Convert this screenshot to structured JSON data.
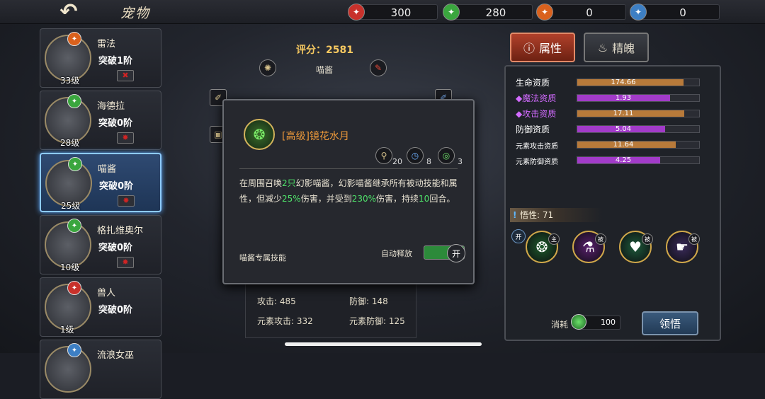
{
  "header": {
    "title": "宠物",
    "back_icon": "back-arrow-icon",
    "currencies": [
      {
        "icon": "red-crystal-icon",
        "color": "#c8312b",
        "value": "300"
      },
      {
        "icon": "green-crystal-icon",
        "color": "#3aa63e",
        "value": "280"
      },
      {
        "icon": "orange-crystal-icon",
        "color": "#d9611d",
        "value": "0"
      },
      {
        "icon": "blue-crystal-icon",
        "color": "#3d7fc4",
        "value": "0"
      }
    ]
  },
  "pets": [
    {
      "name": "雷法",
      "rank": "突破1阶",
      "level": "33级",
      "element_color": "#d9611d"
    },
    {
      "name": "海德拉",
      "rank": "突破0阶",
      "level": "28级",
      "element_color": "#3aa63e"
    },
    {
      "name": "喵酱",
      "rank": "突破0阶",
      "level": "25级",
      "element_color": "#3aa63e",
      "selected": true
    },
    {
      "name": "格扎维奥尔",
      "rank": "突破0阶",
      "level": "10级",
      "element_color": "#3aa63e"
    },
    {
      "name": "兽人",
      "rank": "突破0阶",
      "level": "1级",
      "element_color": "#c8312b"
    },
    {
      "name": "流浪女巫",
      "rank": "",
      "level": "",
      "element_color": "#3d7fc4"
    }
  ],
  "center": {
    "score_label": "评分：2581",
    "pet_name": "喵酱",
    "stats": {
      "attack": "攻击: 485",
      "defense": "防御: 148",
      "elem_attack": "元素攻击: 332",
      "elem_defense": "元素防御: 125"
    }
  },
  "skill_popup": {
    "title": "[高级]镜花水月",
    "cost": "20",
    "cooldown": "8",
    "range": "3",
    "desc_parts": {
      "p1": "在周围召唤",
      "n1": "2只",
      "p2": "幻影喵酱，幻影喵酱继承所有被动技能和属性，但减少",
      "n2": "25%",
      "p3": "伤害，并受到",
      "n3": "230%",
      "p4": "伤害，持续",
      "n4": "10",
      "p5": "回合。"
    },
    "type_label": "喵酱专属技能",
    "auto_label": "自动释放",
    "toggle_label": "开"
  },
  "right": {
    "tabs": [
      {
        "label": "属性",
        "icon": "info-icon"
      },
      {
        "label": "精魄",
        "icon": "flame-icon"
      }
    ],
    "attributes": [
      {
        "label": "生命资质",
        "value": "174.66",
        "fill": 0.87,
        "color": "#b87a3a",
        "style": "normal"
      },
      {
        "label": "◆魔法资质",
        "value": "1.93",
        "fill": 0.76,
        "color": "#a23bc9",
        "style": "purple"
      },
      {
        "label": "◆攻击资质",
        "value": "17.11",
        "fill": 0.88,
        "color": "#b87a3a",
        "style": "purple"
      },
      {
        "label": "防御资质",
        "value": "5.04",
        "fill": 0.72,
        "color": "#a23bc9",
        "style": "normal"
      },
      {
        "label": "元素攻击资质",
        "value": "11.64",
        "fill": 0.81,
        "color": "#b87a3a",
        "style": "small"
      },
      {
        "label": "元素防御资质",
        "value": "4.25",
        "fill": 0.68,
        "color": "#a23bc9",
        "style": "small"
      }
    ],
    "insight": "悟性: 71",
    "open_badge": "开",
    "abilities": [
      {
        "tag": "主",
        "bg": "#1d5a2a"
      },
      {
        "tag": "被",
        "bg": "#5a1f6e"
      },
      {
        "tag": "被",
        "bg": "#1d5a3a"
      },
      {
        "tag": "被",
        "bg": "#3a2a5a"
      }
    ],
    "cost_label": "消耗",
    "cost_value": "100",
    "comprehend_label": "领悟"
  }
}
